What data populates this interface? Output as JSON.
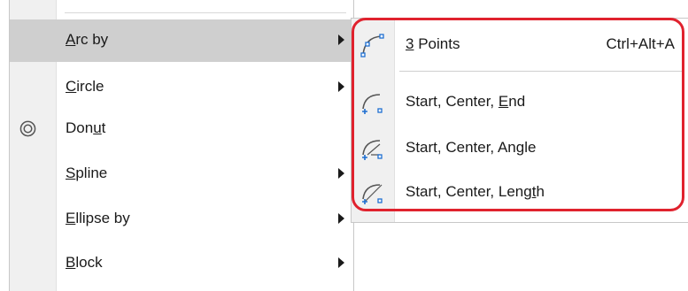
{
  "main_menu": {
    "items": [
      {
        "pre": "",
        "ul": "A",
        "post": "rc by",
        "has_submenu": true,
        "highlighted": true
      },
      {
        "pre": "",
        "ul": "C",
        "post": "ircle",
        "has_submenu": true,
        "highlighted": false
      },
      {
        "pre": "Don",
        "ul": "u",
        "post": "t",
        "has_submenu": false,
        "highlighted": false,
        "icon": "donut-icon"
      },
      {
        "pre": "",
        "ul": "S",
        "post": "pline",
        "has_submenu": true,
        "highlighted": false
      },
      {
        "pre": "",
        "ul": "E",
        "post": "llipse by",
        "has_submenu": true,
        "highlighted": false
      },
      {
        "pre": "",
        "ul": "B",
        "post": "lock",
        "has_submenu": true,
        "highlighted": false
      }
    ]
  },
  "arc_submenu": {
    "items": [
      {
        "pre": "",
        "ul": "3",
        "post": " Points",
        "shortcut": "Ctrl+Alt+A",
        "icon": "arc-3points-icon"
      },
      {
        "pre": "Start, Center, ",
        "ul": "E",
        "post": "nd",
        "shortcut": "",
        "icon": "arc-start-center-end-icon"
      },
      {
        "pre": "Start, Center, An",
        "ul": "g",
        "post": "le",
        "shortcut": "",
        "icon": "arc-start-center-angle-icon"
      },
      {
        "pre": "Start, Center, Leng",
        "ul": "t",
        "post": "h",
        "shortcut": "",
        "icon": "arc-start-center-length-icon"
      }
    ]
  },
  "colors": {
    "highlight": "#cfcfcf",
    "annotation_outline": "#e0222e",
    "icon_blue": "#1f6fd1",
    "icon_gray": "#555555"
  }
}
